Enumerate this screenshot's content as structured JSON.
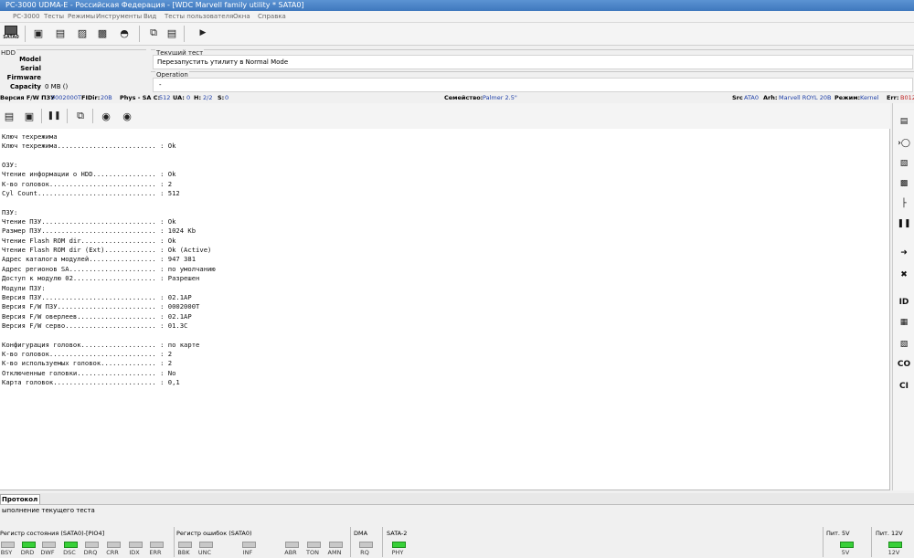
{
  "window": {
    "app_icon": "pc3000-icon",
    "title": "PC-3000 UDMA-E - Российская Федерация - [WDC Marvell family utility * SATA0]"
  },
  "menu": [
    "PC-3000",
    "Тесты",
    "Режимы",
    "Инструменты",
    "Вид",
    "Тесты пользователя",
    "Окна",
    "Справка"
  ],
  "toolbar": {
    "port_label": "SATA0"
  },
  "hdd": {
    "frame_caption": "HDD",
    "model_label": "Model",
    "serial_label": "Serial",
    "firmware_label": "Firmware",
    "capacity_label": "Capacity",
    "capacity_value": "0 MB ()"
  },
  "current_test": {
    "caption": "Текущий тест",
    "text": "Перезапустить утилиту в Normal Mode"
  },
  "operation": {
    "caption": "Operation",
    "text": "-"
  },
  "status": {
    "fw_label": "Версия F/W ПЗУ",
    "fw_value": "0002000T",
    "fidir_label": "FIDir:",
    "fidir_value": "20B",
    "phys_label": "Phys - SA C:",
    "phys_value": "512",
    "ua_label": "UA:",
    "ua_value": "0",
    "h_label": "H:",
    "h_value": "2/2",
    "s_label": "S:",
    "s_value": "0",
    "family_label": "Семейство:",
    "family_value": "Palmer 2.5\"",
    "src_label": "Src",
    "src_value": "ATA0",
    "arh_label": "Arh:",
    "arh_value": "Marvell ROYL 20B",
    "mode_label": "Режим:",
    "mode_value": "Kernel",
    "err_label": "Err:",
    "err_value": "B012"
  },
  "log": {
    "lines": [
      "Ключ техрежима",
      "Ключ техрежима......................... : Ok",
      "",
      "ОЗУ:",
      "Чтение информации о HDD................ : Ok",
      "К-во головок........................... : 2",
      "Cyl Count.............................. : 512",
      "",
      "ПЗУ:",
      "Чтение ПЗУ............................. : Ok",
      "Размер ПЗУ............................. : 1024 Kb",
      "Чтение Flash ROM dir................... : Ok",
      "Чтение Flash ROM dir (Ext)............. : Ok (Active)",
      "Адрес каталога модулей................. : 947 381",
      "Адрес регионов SA...................... : по умолчанию",
      "Доступ к модулю 02..................... : Разрешен",
      "Модули ПЗУ:",
      "Версия ПЗУ............................. : 02.1AP",
      "Версия F/W ПЗУ......................... : 0002000T",
      "Версия F/W оверлеев.................... : 02.1AP",
      "Версия F/W серво....................... : 01.3C",
      "",
      "Конфигурация головок................... : по карте",
      "К-во головок........................... : 2",
      "К-во используемых головок.............. : 2",
      "Отключенные головки.................... : No",
      "Карта головок.......................... : 0,1"
    ]
  },
  "rightbar": [
    "ID",
    "CO",
    "CI"
  ],
  "tabs": {
    "protocol": "Протокол"
  },
  "current_test_line": "ыполнение текущего теста",
  "panels": {
    "state": {
      "caption": "Регистр состояния (SATA0)-[PIO4]",
      "leds": [
        {
          "label": "BSY",
          "on": false
        },
        {
          "label": "DRD",
          "on": true
        },
        {
          "label": "DWF",
          "on": false
        },
        {
          "label": "DSC",
          "on": true
        },
        {
          "label": "DRQ",
          "on": false
        },
        {
          "label": "CRR",
          "on": false
        },
        {
          "label": "IDX",
          "on": false
        },
        {
          "label": "ERR",
          "on": false
        }
      ]
    },
    "errors": {
      "caption": "Регистр ошибок  (SATA0)",
      "leds": [
        {
          "label": "BBK",
          "on": false
        },
        {
          "label": "UNC",
          "on": false
        },
        {
          "label": "INF",
          "on": false
        },
        {
          "label": "ABR",
          "on": false
        },
        {
          "label": "TON",
          "on": false
        },
        {
          "label": "AMN",
          "on": false
        }
      ]
    },
    "dma": {
      "caption": "DMA",
      "leds": [
        {
          "label": "RQ",
          "on": false
        }
      ]
    },
    "sata2": {
      "caption": "SATA-2",
      "leds": [
        {
          "label": "PHY",
          "on": true
        }
      ]
    },
    "power5": {
      "caption": "Пит. 5V",
      "leds": [
        {
          "label": "5V",
          "on": true
        }
      ]
    },
    "power12": {
      "caption": "Пит. 12V",
      "leds": [
        {
          "label": "12V",
          "on": true
        }
      ]
    }
  },
  "colors": {
    "accent_blue": "#1e3fa8",
    "led_on": "#38d038",
    "led_off": "#c8c8c8",
    "error_red": "#c02020"
  }
}
